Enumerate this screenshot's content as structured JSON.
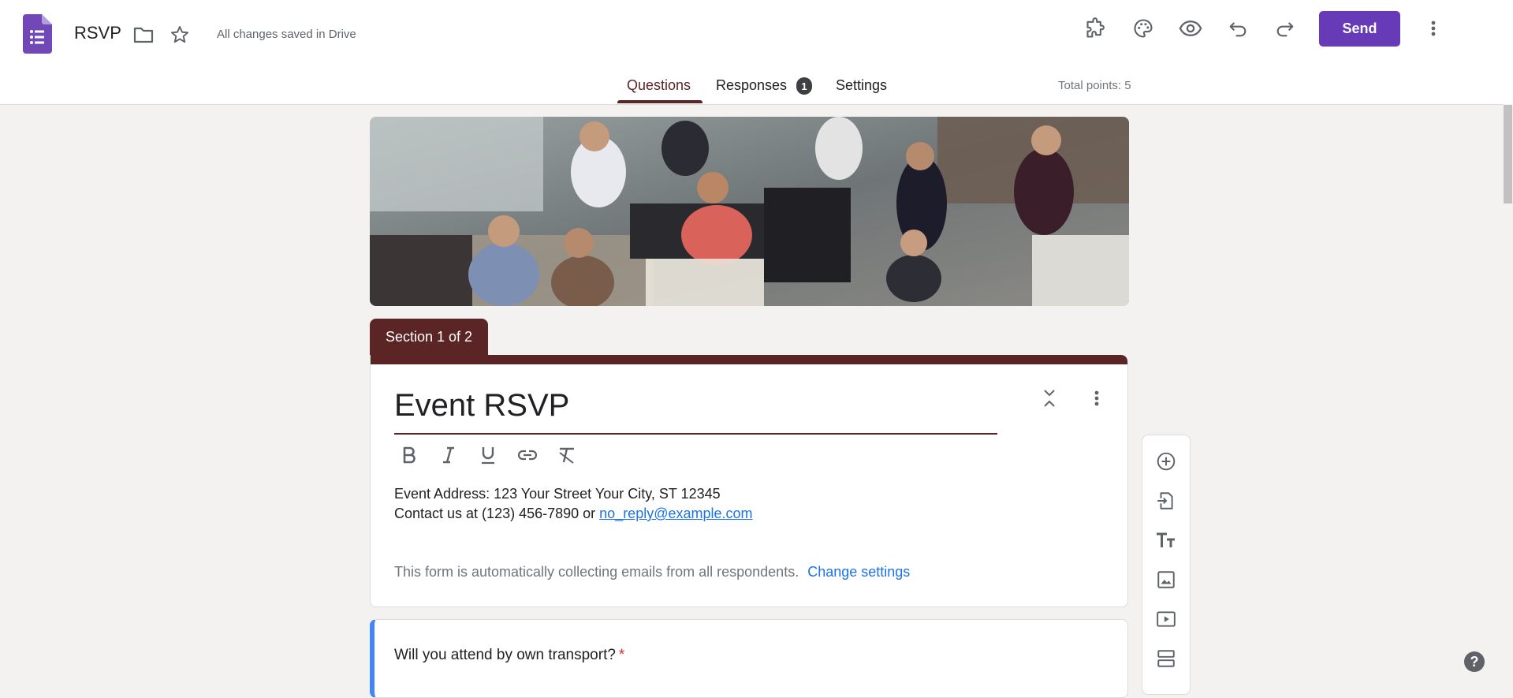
{
  "app": {
    "title": "RSVP",
    "save_status": "All changes saved in Drive",
    "icons": [
      "forms-logo-icon",
      "folder-icon",
      "star-icon",
      "add-ons-icon",
      "palette-icon",
      "preview-eye-icon",
      "undo-icon",
      "redo-icon",
      "more-vert-icon"
    ]
  },
  "header": {
    "send_label": "Send"
  },
  "tabs": [
    {
      "label": "Questions",
      "active": true
    },
    {
      "label": "Responses",
      "badge": "1"
    },
    {
      "label": "Settings"
    }
  ],
  "total_points": "Total points: 5",
  "section": {
    "label": "Section 1 of 2",
    "title": "Event RSVP",
    "description_line1": "Event Address: 123 Your Street Your City, ST 12345",
    "description_line2_prefix": "Contact us at (123) 456-7890 or ",
    "email_link": "no_reply@example.com",
    "collect_note": "This form is automatically collecting emails from all respondents.",
    "change_settings": "Change settings"
  },
  "question": {
    "title": "Will you attend by own transport?",
    "required_mark": "*"
  },
  "toolbar_icons": [
    "add-question-icon",
    "import-questions-icon",
    "add-title-icon",
    "add-image-icon",
    "add-video-icon",
    "add-section-icon"
  ],
  "help": "?",
  "colors": {
    "accent": "#673ab7",
    "theme": "#5b2525",
    "background": "#f4f2f0",
    "question_highlight": "#4285f4",
    "link": "#1a73e8",
    "required": "#d93025"
  }
}
